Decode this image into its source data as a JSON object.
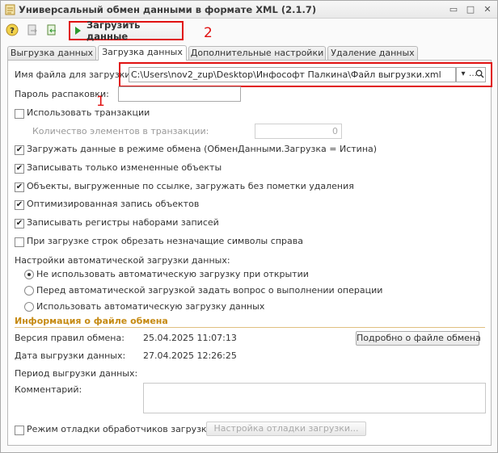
{
  "window": {
    "title": "Универсальный обмен данными в формате XML (2.1.7)",
    "controls": {
      "restore": "▭",
      "maximize": "□",
      "close": "✕"
    }
  },
  "toolbar": {
    "load_button": "Загрузить данные",
    "icons": [
      "help-icon",
      "export-icon",
      "import-icon",
      "play-icon"
    ]
  },
  "annotations": {
    "one": "1",
    "two": "2"
  },
  "tabs": [
    {
      "label": "Выгрузка данных"
    },
    {
      "label": "Загрузка данных"
    },
    {
      "label": "Дополнительные настройки"
    },
    {
      "label": "Удаление данных"
    }
  ],
  "form": {
    "file_label": "Имя файла для загрузки:",
    "file_value": "C:\\Users\\nov2_zup\\Desktop\\Инфософт Палкина\\Файл выгрузки.xml",
    "password_label": "Пароль распаковки:",
    "password_value": "",
    "use_transactions": "Использовать транзакции",
    "tx_count_label": "Количество элементов в транзакции:",
    "tx_count_value": "0",
    "cb_exchange_mode": "Загружать данные в режиме обмена (ОбменДанными.Загрузка = Истина)",
    "cb_only_changed": "Записывать только измененные объекты",
    "cb_by_ref": "Объекты, выгруженные по ссылке, загружать без пометки удаления",
    "cb_optimized": "Оптимизированная запись объектов",
    "cb_registers": "Записывать регистры наборами записей",
    "cb_trim": "При загрузке строк обрезать незначащие символы справа",
    "auto_label": "Настройки автоматической загрузки данных:",
    "radio_no_auto": "Не использовать автоматическую загрузку при открытии",
    "radio_ask": "Перед автоматической загрузкой задать вопрос о выполнении операции",
    "radio_auto": "Использовать автоматическую загрузку данных"
  },
  "info": {
    "section_title": "Информация о файле обмена",
    "rules_version_label": "Версия правил обмена:",
    "rules_version_value": "25.04.2025 11:07:13",
    "details_button": "Подробно о файле обмена",
    "export_date_label": "Дата выгрузки данных:",
    "export_date_value": "27.04.2025 12:26:25",
    "period_label": "Период выгрузки данных:",
    "comment_label": "Комментарий:",
    "debug_label": "Режим отладки обработчиков загрузки",
    "debug_settings_button": "Настройка отладки загрузки..."
  },
  "checkbox_states": {
    "use_transactions": false,
    "exchange_mode": true,
    "only_changed": true,
    "by_ref": true,
    "optimized": true,
    "registers": true,
    "trim": false,
    "debug": false
  },
  "colors": {
    "annotation_red": "#e01010",
    "section_orange": "#c68a12",
    "play_green": "#2e9a2e"
  }
}
